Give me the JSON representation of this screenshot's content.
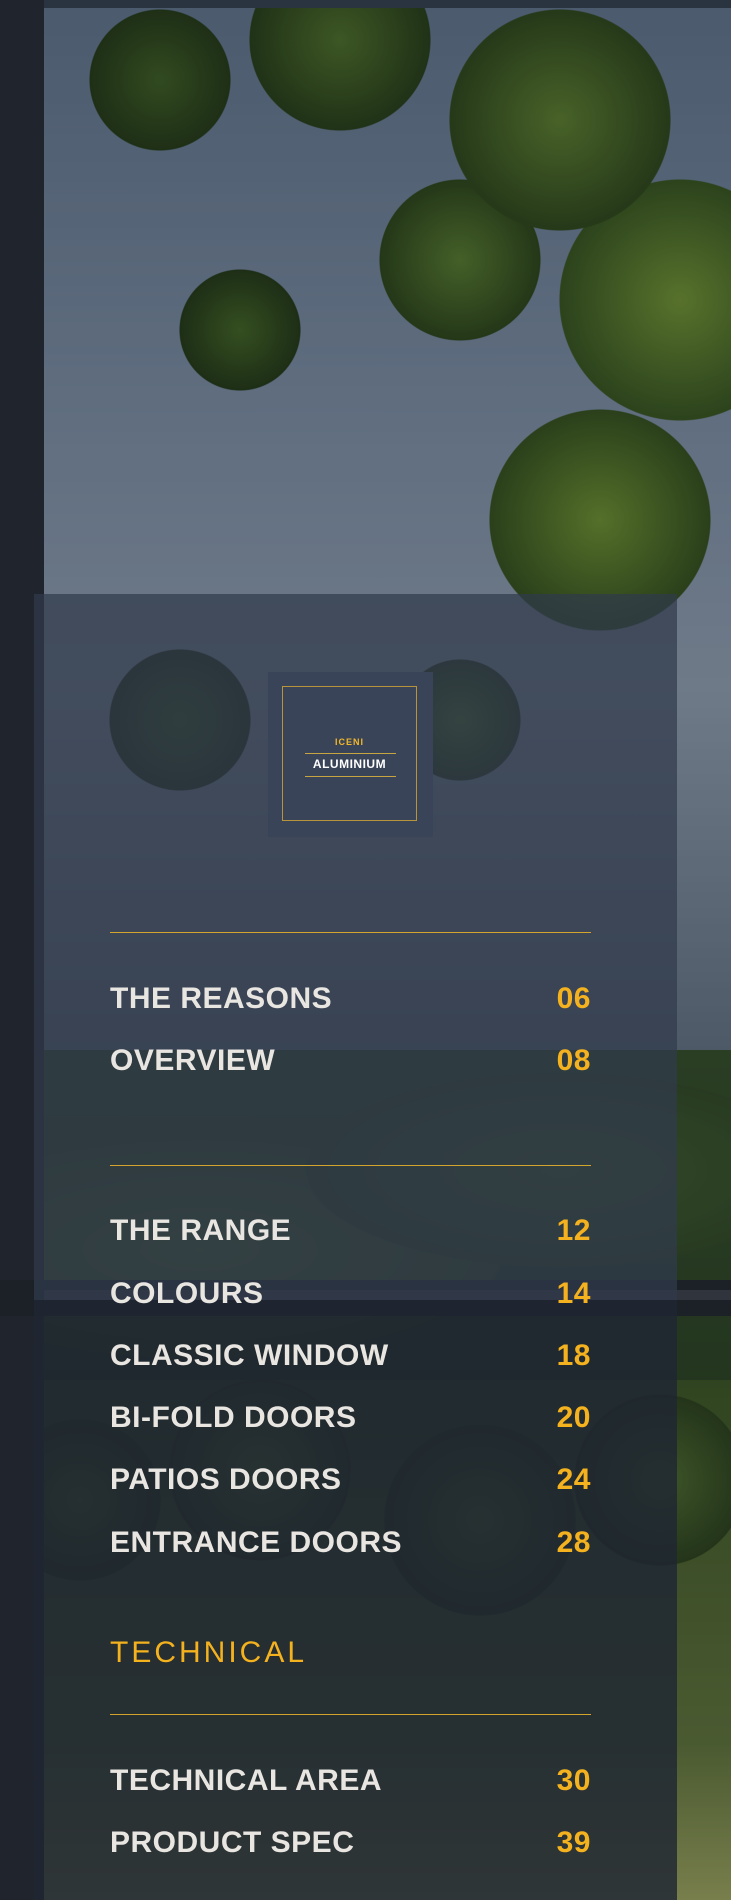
{
  "logo": {
    "brand": "ICENI",
    "product": "ALUMINIUM"
  },
  "contents": {
    "group1": [
      {
        "label": "THE REASONS",
        "page": "06"
      },
      {
        "label": "OVERVIEW",
        "page": "08"
      }
    ],
    "group2": [
      {
        "label": "THE RANGE",
        "page": "12"
      },
      {
        "label": "COLOURS",
        "page": "14"
      },
      {
        "label": "CLASSIC WINDOW",
        "page": "18"
      },
      {
        "label": "BI-FOLD DOORS",
        "page": "20"
      },
      {
        "label": "PATIOS DOORS",
        "page": "24"
      },
      {
        "label": "ENTRANCE DOORS",
        "page": "28"
      }
    ],
    "technical_heading": "TECHNICAL",
    "group3": [
      {
        "label": "TECHNICAL AREA",
        "page": "30"
      },
      {
        "label": "PRODUCT SPEC",
        "page": "39"
      }
    ]
  },
  "colors": {
    "accent": "#f5b21f",
    "text": "#e9e6e2",
    "panel": "#303a4c"
  }
}
